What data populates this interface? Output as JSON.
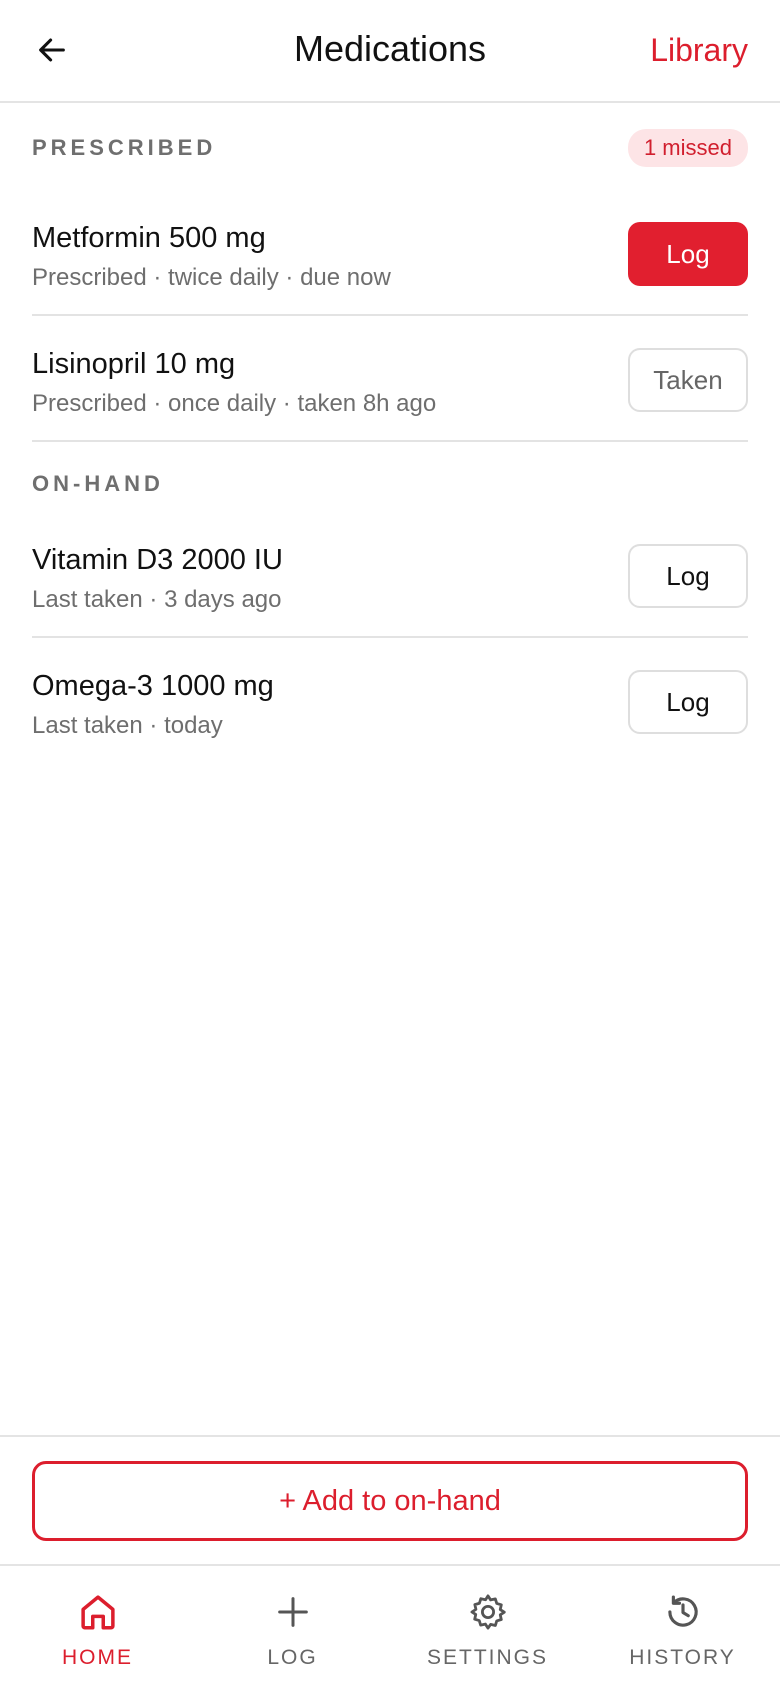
{
  "header": {
    "title": "Medications",
    "library_label": "Library"
  },
  "prescribed": {
    "label": "PRESCRIBED",
    "badge": "1 missed",
    "items": [
      {
        "name": "Metformin 500 mg",
        "detail": "Prescribed · twice daily · due now",
        "action": "Log"
      },
      {
        "name": "Lisinopril 10 mg",
        "detail": "Prescribed · once daily · taken 8h ago",
        "action": "Taken"
      }
    ]
  },
  "onhand": {
    "label": "ON-HAND",
    "items": [
      {
        "name": "Vitamin D3 2000 IU",
        "detail": "Last taken · 3 days ago",
        "action": "Log"
      },
      {
        "name": "Omega-3 1000 mg",
        "detail": "Last taken · today",
        "action": "Log"
      }
    ]
  },
  "add_button": "+ Add to on-hand",
  "nav": [
    {
      "label": "HOME",
      "icon": "home-icon"
    },
    {
      "label": "LOG",
      "icon": "plus-icon"
    },
    {
      "label": "SETTINGS",
      "icon": "gear-icon"
    },
    {
      "label": "HISTORY",
      "icon": "history-icon"
    }
  ],
  "colors": {
    "accent": "#dc1e2d",
    "badge_bg": "#fde4e6",
    "muted_text": "#6e6e6e"
  }
}
